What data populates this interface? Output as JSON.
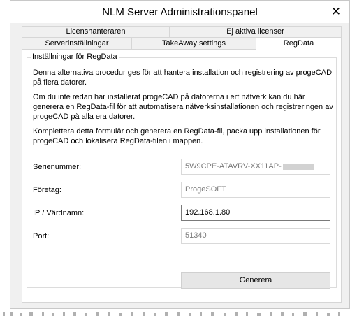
{
  "window": {
    "title": "NLM Server Administrationspanel",
    "close_glyph": "✕"
  },
  "tabs": {
    "row1": [
      {
        "label": "Licenshanteraren"
      },
      {
        "label": "Ej aktiva licenser"
      }
    ],
    "row2": [
      {
        "label": "Serverinställningar"
      },
      {
        "label": "TakeAway settings"
      },
      {
        "label": "RegData",
        "selected": true
      }
    ]
  },
  "group": {
    "legend": "Inställningar för RegData",
    "paragraphs": [
      "Denna alternativa procedur ges för att hantera installation och registrering av progeCAD på flera datorer.",
      "Om du inte redan har installerat progeCAD på datorerna i ert nätverk kan du här generera en RegData-fil för att automatisera nätverksinstallationen och registreringen av progeCAD på alla era datorer.",
      "Komplettera detta formulär och generera en RegData-fil, packa upp installationen för progeCAD och lokalisera RegData-filen i mappen."
    ]
  },
  "fields": {
    "serial": {
      "label": "Serienummer:",
      "value": "5W9CPE-ATAVRV-XX11AP-"
    },
    "company": {
      "label": "Företag:",
      "value": "ProgeSOFT"
    },
    "ip": {
      "label": "IP / Värdnamn:",
      "value": "192.168.1.80"
    },
    "port": {
      "label": "Port:",
      "value": "51340"
    }
  },
  "buttons": {
    "generate": "Generera"
  },
  "icons": {
    "close": "close-icon"
  }
}
